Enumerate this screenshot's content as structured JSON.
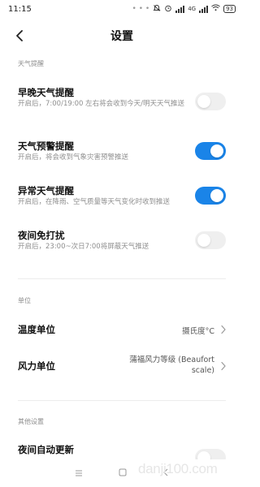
{
  "status": {
    "time": "11:15",
    "dots": "• • •",
    "network": "4G",
    "battery": "93"
  },
  "nav": {
    "title": "设置"
  },
  "sections": {
    "weather_alerts": "天气提醒",
    "units": "单位",
    "other": "其他设置"
  },
  "rows": {
    "morning_evening": {
      "title": "早晚天气提醒",
      "subtitle": "开启后，7:00/19:00 左右将会收到今天/明天天气推送",
      "enabled": false
    },
    "warning": {
      "title": "天气预警提醒",
      "subtitle": "开启后，将会收到气象灾害预警推送",
      "enabled": true
    },
    "abnormal": {
      "title": "异常天气提醒",
      "subtitle": "开启后，在降雨、空气质量等天气变化时收到推送",
      "enabled": true
    },
    "night_dnd": {
      "title": "夜间免打扰",
      "subtitle": "开启后，23:00~次日7:00将屏蔽天气推送",
      "enabled": false
    },
    "temp_unit": {
      "title": "温度单位",
      "value": "摄氏度°C"
    },
    "wind_unit": {
      "title": "风力单位",
      "value_line1": "蒲福风力等级 (Beaufort",
      "value_line2": "scale)"
    },
    "night_update": {
      "title": "夜间自动更新"
    }
  },
  "watermark": {
    "prefix": "danji",
    "suffix": "100.com"
  },
  "colors": {
    "accent": "#1a84e8",
    "toggle_off": "#efefef"
  }
}
